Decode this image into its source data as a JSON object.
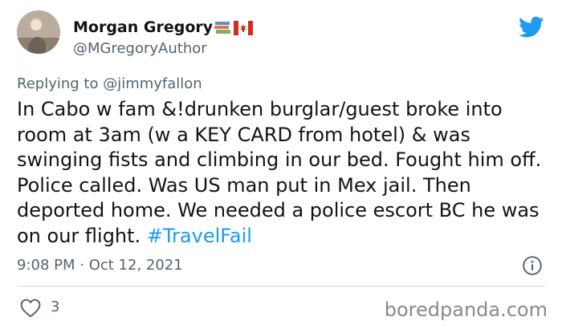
{
  "tweet": {
    "author": {
      "display_name": "Morgan Gregory",
      "handle": "@MGregoryAuthor",
      "badges": [
        "books-emoji",
        "canada-flag-emoji"
      ]
    },
    "reply_prefix": "Replying to ",
    "reply_to": "@jimmyfallon",
    "text": "In Cabo w fam &!drunken burglar/guest broke into room at 3am (w a KEY CARD from hotel) & was swinging fists and climbing in our bed. Fought him off. Police called. Was US man put in Mex jail. Then deported home. We needed a police escort BC he was on our flight. ",
    "hashtag": "#TravelFail",
    "timestamp": "9:08 PM · Oct 12, 2021",
    "like_count": "3"
  },
  "icons": {
    "logo": "twitter-bird-icon",
    "info": "info-icon",
    "like": "heart-icon"
  },
  "colors": {
    "accent": "#1d9bf0",
    "text": "#0f1419",
    "secondary": "#536471",
    "divider": "#cfd9de"
  },
  "watermark": "boredpanda.com"
}
